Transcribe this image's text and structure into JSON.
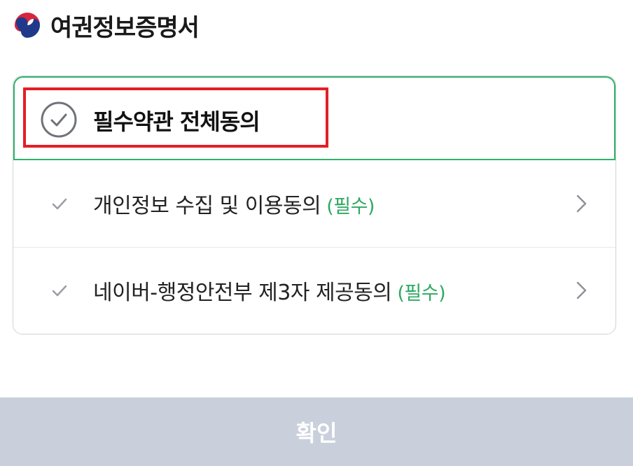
{
  "header": {
    "title": "여권정보증명서",
    "logo_icon": "taegeuk-emblem-icon"
  },
  "agreement": {
    "all_label": "필수약관 전체동의",
    "all_checked": false,
    "terms": [
      {
        "label": "개인정보 수집 및 이용동의",
        "tag": "(필수)",
        "checked": false
      },
      {
        "label": "네이버-행정안전부 제3자 제공동의",
        "tag": "(필수)",
        "checked": false
      }
    ]
  },
  "footer": {
    "confirm_label": "확인"
  },
  "colors": {
    "accent_green": "#2fb36a",
    "required_green": "#2fa862",
    "highlight_red": "#e41e26",
    "button_disabled": "#c9d0dc",
    "title_text": "#1a1a1a"
  }
}
